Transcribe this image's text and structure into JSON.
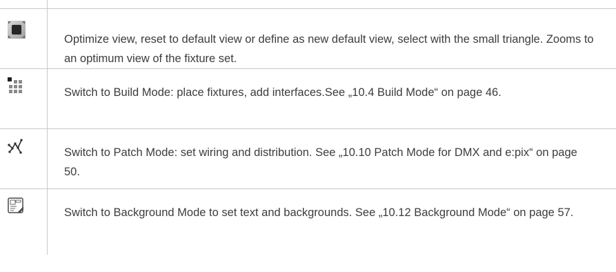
{
  "header_fragment": "",
  "rows": [
    {
      "icon": "optimize-view-icon",
      "text": "Optimize view, reset to default view or define as new default view, select with the small triangle. Zooms to an optimum view of the fixture set."
    },
    {
      "icon": "build-mode-icon",
      "text": "Switch to Build Mode: place fixtures, add interfaces.See „10.4 Build Mode“ on page 46."
    },
    {
      "icon": "patch-mode-icon",
      "text": "Switch to Patch Mode: set wiring and distribution. See „10.10 Patch Mode for DMX and e:pix“ on page 50."
    },
    {
      "icon": "background-mode-icon",
      "text": "Switch to Background Mode to set text and backgrounds. See „10.12 Background Mode“ on page 57."
    }
  ],
  "colors": {
    "text": "#3c3c3c",
    "rule": "#c8c8c8",
    "icon_dark": "#2b2b2b",
    "icon_grey": "#8a8a8a"
  }
}
